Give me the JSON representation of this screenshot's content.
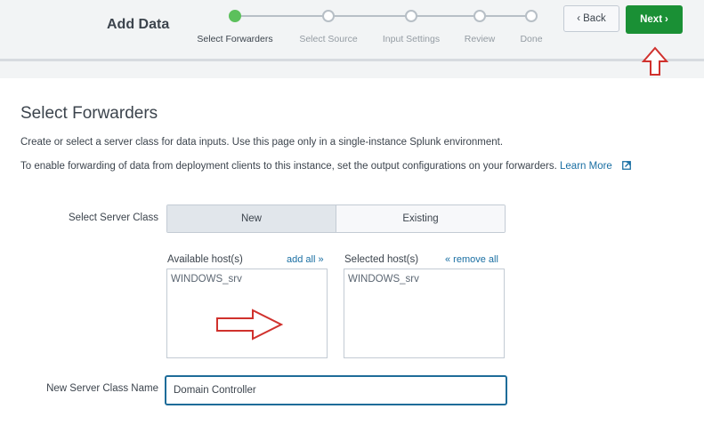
{
  "header": {
    "title": "Add Data",
    "back_label": "Back",
    "next_label": "Next",
    "steps": [
      {
        "label": "Select Forwarders",
        "state": "active"
      },
      {
        "label": "Select Source",
        "state": "pending"
      },
      {
        "label": "Input Settings",
        "state": "pending"
      },
      {
        "label": "Review",
        "state": "pending"
      },
      {
        "label": "Done",
        "state": "pending"
      }
    ]
  },
  "main": {
    "title": "Select Forwarders",
    "description": "Create or select a server class for data inputs. Use this page only in a single-instance Splunk environment.",
    "forwarding_note": "To enable forwarding of data from deployment clients to this instance, set the output configurations on your forwarders.",
    "learn_more": "Learn More"
  },
  "server_class": {
    "label": "Select Server Class",
    "options": [
      "New",
      "Existing"
    ],
    "selected": "New"
  },
  "hosts": {
    "available_label": "Available host(s)",
    "add_all": "add all »",
    "available": [
      "WINDOWS_srv"
    ],
    "selected_label": "Selected host(s)",
    "remove_all": "« remove all",
    "selected": [
      "WINDOWS_srv"
    ]
  },
  "new_server_class": {
    "label": "New Server Class Name",
    "value": "Domain Controller"
  },
  "annotations": {
    "color": "#d0312d"
  },
  "colors": {
    "active_step": "#5cc05c",
    "next_button": "#1a9035",
    "link": "#1a6fa3",
    "input_focus": "#1e6c99"
  }
}
